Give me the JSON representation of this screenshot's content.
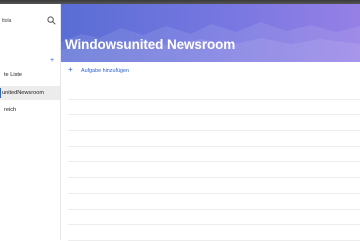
{
  "sidebar": {
    "account": "ttola",
    "lists": [
      {
        "label": "te Liste"
      },
      {
        "label": "unitedNewsroom"
      },
      {
        "label": "reich"
      }
    ],
    "active_index": 1
  },
  "main": {
    "title": "Windowsunited Newsroom",
    "add_task_label": "Aufgabe hinzufügen"
  },
  "colors": {
    "accent": "#2b63d9",
    "header_start": "#5b6fd6",
    "header_end": "#9b83e8"
  }
}
